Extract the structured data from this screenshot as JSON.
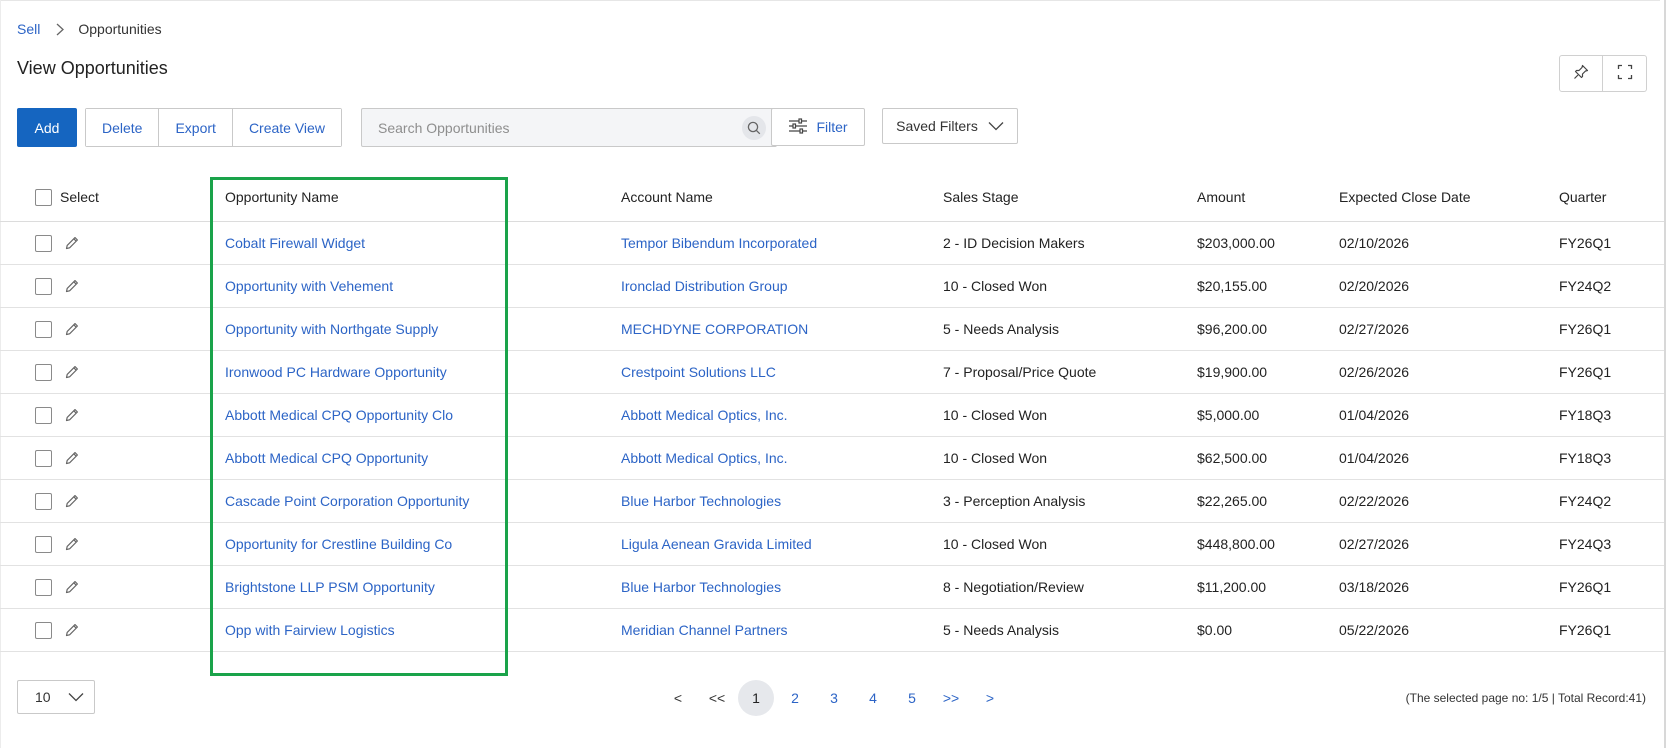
{
  "breadcrumb": {
    "parent": "Sell",
    "current": "Opportunities"
  },
  "page_title": "View Opportunities",
  "toolbar": {
    "add_label": "Add",
    "delete_label": "Delete",
    "export_label": "Export",
    "create_view_label": "Create View",
    "search_placeholder": "Search Opportunities",
    "filter_label": "Filter",
    "saved_filters_label": "Saved Filters"
  },
  "table": {
    "headers": {
      "select": "Select",
      "opportunity_name": "Opportunity Name",
      "account_name": "Account Name",
      "sales_stage": "Sales Stage",
      "amount": "Amount",
      "expected_close_date": "Expected Close Date",
      "quarter": "Quarter"
    },
    "rows": [
      {
        "opportunity": "Cobalt Firewall Widget",
        "account": "Tempor Bibendum Incorporated",
        "stage": "2 - ID Decision Makers",
        "amount": "$203,000.00",
        "close": "02/10/2026",
        "quarter": "FY26Q1"
      },
      {
        "opportunity": "Opportunity with Vehement",
        "account": "Ironclad Distribution Group",
        "stage": "10 - Closed Won",
        "amount": "$20,155.00",
        "close": "02/20/2026",
        "quarter": "FY24Q2"
      },
      {
        "opportunity": "Opportunity with Northgate Supply",
        "account": "MECHDYNE CORPORATION",
        "stage": "5 - Needs Analysis",
        "amount": "$96,200.00",
        "close": "02/27/2026",
        "quarter": "FY26Q1"
      },
      {
        "opportunity": "Ironwood PC Hardware Opportunity",
        "account": "Crestpoint Solutions LLC",
        "stage": "7 - Proposal/Price Quote",
        "amount": "$19,900.00",
        "close": "02/26/2026",
        "quarter": "FY26Q1"
      },
      {
        "opportunity": "Abbott Medical CPQ Opportunity Clo",
        "account": "Abbott Medical Optics, Inc.",
        "stage": "10 - Closed Won",
        "amount": "$5,000.00",
        "close": "01/04/2026",
        "quarter": "FY18Q3"
      },
      {
        "opportunity": "Abbott Medical CPQ Opportunity",
        "account": "Abbott Medical Optics, Inc.",
        "stage": "10 - Closed Won",
        "amount": "$62,500.00",
        "close": "01/04/2026",
        "quarter": "FY18Q3"
      },
      {
        "opportunity": "Cascade Point Corporation Opportunity",
        "account": "Blue Harbor Technologies",
        "stage": "3 - Perception Analysis",
        "amount": "$22,265.00",
        "close": "02/22/2026",
        "quarter": "FY24Q2"
      },
      {
        "opportunity": "Opportunity for Crestline Building Co",
        "account": "Ligula Aenean Gravida Limited",
        "stage": "10 - Closed Won",
        "amount": "$448,800.00",
        "close": "02/27/2026",
        "quarter": "FY24Q3"
      },
      {
        "opportunity": "Brightstone LLP PSM Opportunity",
        "account": "Blue Harbor Technologies",
        "stage": "8 - Negotiation/Review",
        "amount": "$11,200.00",
        "close": "03/18/2026",
        "quarter": "FY26Q1"
      },
      {
        "opportunity": "Opp with Fairview Logistics",
        "account": "Meridian Channel Partners",
        "stage": "5 - Needs Analysis",
        "amount": "$0.00",
        "close": "05/22/2026",
        "quarter": "FY26Q1"
      }
    ]
  },
  "footer": {
    "page_size": "10",
    "pager": {
      "prev": "<",
      "first": "<<",
      "pages": [
        "1",
        "2",
        "3",
        "4",
        "5"
      ],
      "last": ">>",
      "next": ">"
    },
    "record_info": "(The selected page no: 1/5 | Total Record:41)"
  },
  "colors": {
    "primary": "#1565c0",
    "link": "#2c64c6",
    "highlight": "#1aa34a"
  }
}
